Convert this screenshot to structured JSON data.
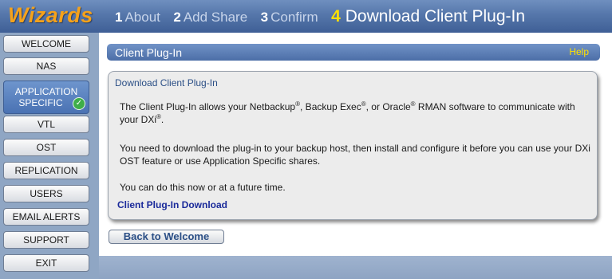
{
  "header": {
    "brand": "Wizards",
    "steps": [
      {
        "num": "1",
        "label": "About"
      },
      {
        "num": "2",
        "label": "Add Share"
      },
      {
        "num": "3",
        "label": "Confirm"
      },
      {
        "num": "4",
        "label": "Download Client Plug-In"
      }
    ]
  },
  "sidebar": {
    "items": [
      {
        "label": "WELCOME"
      },
      {
        "label": "NAS"
      },
      {
        "label_line1": "APPLICATION",
        "label_line2": "SPECIFIC"
      },
      {
        "label": "VTL"
      },
      {
        "label": "OST"
      },
      {
        "label": "REPLICATION"
      },
      {
        "label": "USERS"
      },
      {
        "label": "EMAIL ALERTS"
      },
      {
        "label": "SUPPORT"
      },
      {
        "label": "EXIT"
      }
    ]
  },
  "main": {
    "titlebar": {
      "title": "Client Plug-In",
      "help": "Help"
    },
    "panel": {
      "heading": "Download Client Plug-In",
      "p1": {
        "t1": "The Client Plug-In allows your Netbackup",
        "t2": ", Backup Exec",
        "t3": ", or Oracle",
        "t4": " RMAN software to communicate with your DXi",
        "t5": ".",
        "reg": "®"
      },
      "p2": "You need to download the plug-in to your backup host, then install and configure it before you can use your DXi OST feature or use Application Specific shares.",
      "p3": "You can do this now or at a future time.",
      "link": "Client Plug-In Download"
    },
    "back_button": "Back to Welcome"
  },
  "colors": {
    "brand": "#f5a21b",
    "current_step": "#ffe000",
    "header_blue": "#5576aa",
    "link": "#1a2a9a"
  }
}
